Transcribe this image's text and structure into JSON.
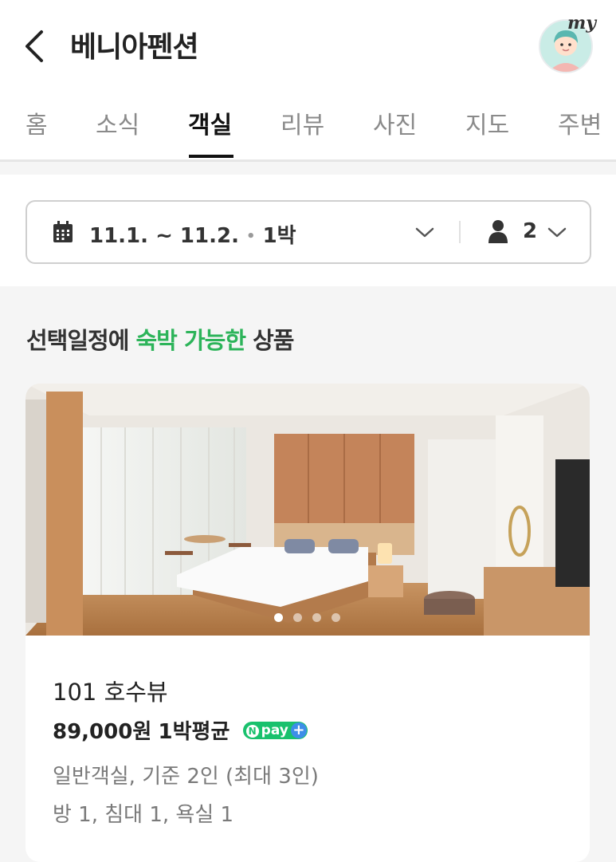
{
  "header": {
    "title": "베니아펜션",
    "my_label": "my"
  },
  "tabs": [
    {
      "label": "홈"
    },
    {
      "label": "소식"
    },
    {
      "label": "객실",
      "active": true
    },
    {
      "label": "리뷰"
    },
    {
      "label": "사진"
    },
    {
      "label": "지도"
    },
    {
      "label": "주변"
    }
  ],
  "filter": {
    "dates": "11.1. ~ 11.2.",
    "separator": "•",
    "nights": "1박",
    "guests": "2"
  },
  "section": {
    "title_prefix": "선택일정에 ",
    "title_highlight": "숙박 가능한",
    "title_suffix": " 상품"
  },
  "room": {
    "name": "101 호수뷰",
    "price": "89,000원",
    "price_note": "1박평균",
    "npay_text": "pay",
    "description": "일반객실, 기준 2인 (최대 3인)",
    "spec": "방 1, 침대 1, 욕실 1",
    "photo_count": 4,
    "photo_index": 1
  },
  "colors": {
    "accent_green": "#2db45a",
    "npay_green": "#19c16d",
    "npay_blue": "#3d8ee8"
  },
  "icons": [
    "back-arrow-icon",
    "avatar-icon",
    "calendar-icon",
    "chevron-down-icon",
    "person-icon"
  ]
}
